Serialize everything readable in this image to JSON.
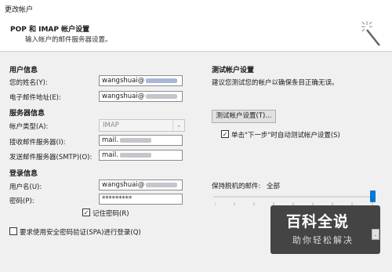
{
  "window": {
    "title": "更改帐户"
  },
  "header": {
    "title": "POP 和 IMAP 帐户设置",
    "subtitle": "输入帐户的邮件服务器设置。"
  },
  "user_info": {
    "section_label": "用户信息",
    "name_label": "您的姓名(Y):",
    "name_value": "wangshuai@",
    "email_label": "电子邮件地址(E):",
    "email_value": "wangshuai@"
  },
  "server_info": {
    "section_label": "服务器信息",
    "account_type_label": "帐户类型(A):",
    "account_type_value": "IMAP",
    "incoming_label": "接收邮件服务器(I):",
    "incoming_value": "mail.",
    "outgoing_label": "发送邮件服务器(SMTP)(O):",
    "outgoing_value": "mail."
  },
  "login_info": {
    "section_label": "登录信息",
    "username_label": "用户名(U):",
    "username_value": "wangshuai@",
    "password_label": "密码(P):",
    "password_value": "*********",
    "remember_password_label": "记住密码(R)",
    "remember_password_checked": true
  },
  "spa": {
    "label": "要求使用安全密码验证(SPA)进行登录(Q)",
    "checked": false
  },
  "test": {
    "section_label": "测试帐户设置",
    "description": "建议您测试您的帐户以确保条目正确无误。",
    "button_label": "测试帐户设置(T)...",
    "auto_test_label": "单击\"下一步\"时自动测试帐户设置(S)",
    "auto_test_checked": true
  },
  "offline": {
    "label": "保持脱机的邮件:",
    "value": "全部",
    "slider_fraction": 1.0
  },
  "watermark": {
    "line1": "百科全说",
    "line2": "助你轻松解决"
  },
  "colors": {
    "accent": "#0078d7",
    "dialog_bg": "#f0f0f0"
  }
}
